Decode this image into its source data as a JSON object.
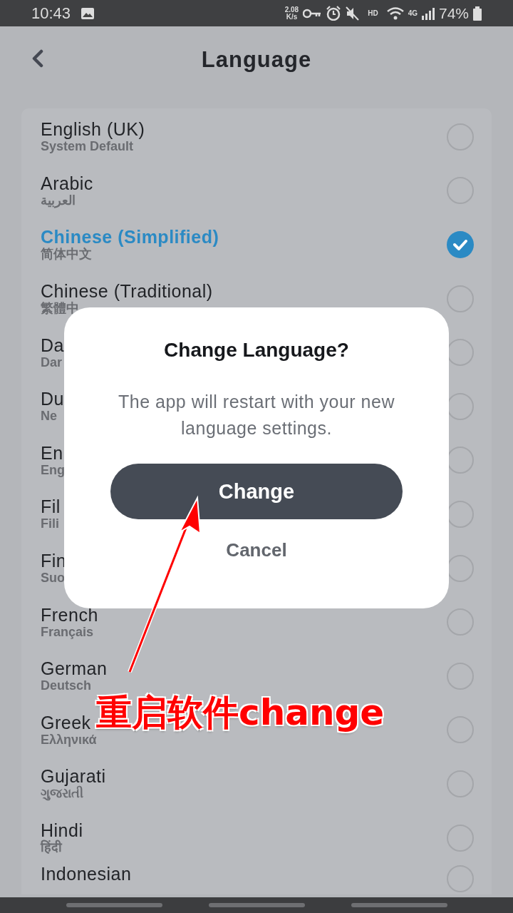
{
  "status_bar": {
    "time": "10:43",
    "net_speed": "2.08",
    "net_unit": "K/s",
    "hd_label": "HD",
    "network_label": "4G",
    "battery_percent": "74%"
  },
  "header": {
    "title": "Language"
  },
  "languages": [
    {
      "name": "English (UK)",
      "native": "System Default",
      "selected": false
    },
    {
      "name": "Arabic",
      "native": "العربية",
      "selected": false
    },
    {
      "name": "Chinese (Simplified)",
      "native": "简体中文",
      "selected": true
    },
    {
      "name": "Chinese (Traditional)",
      "native": "繁體中",
      "selected": false
    },
    {
      "name": "Da",
      "native": "Dar",
      "selected": false
    },
    {
      "name": "Du",
      "native": "Ne",
      "selected": false
    },
    {
      "name": "En",
      "native": "Eng",
      "selected": false
    },
    {
      "name": "Fil",
      "native": "Fili",
      "selected": false
    },
    {
      "name": "Fin",
      "native": "Suo",
      "selected": false
    },
    {
      "name": "French",
      "native": "Français",
      "selected": false
    },
    {
      "name": "German",
      "native": "Deutsch",
      "selected": false
    },
    {
      "name": "Greek",
      "native": "Ελληνικά",
      "selected": false
    },
    {
      "name": "Gujarati",
      "native": "ગુજરાતી",
      "selected": false
    },
    {
      "name": "Hindi",
      "native": "हिंदी",
      "selected": false
    },
    {
      "name": "Indonesian",
      "selected": false
    }
  ],
  "dialog": {
    "title": "Change Language?",
    "message": "The app will restart with your new language settings.",
    "confirm": "Change",
    "cancel": "Cancel"
  },
  "annotation": {
    "text": "重启软件change"
  }
}
